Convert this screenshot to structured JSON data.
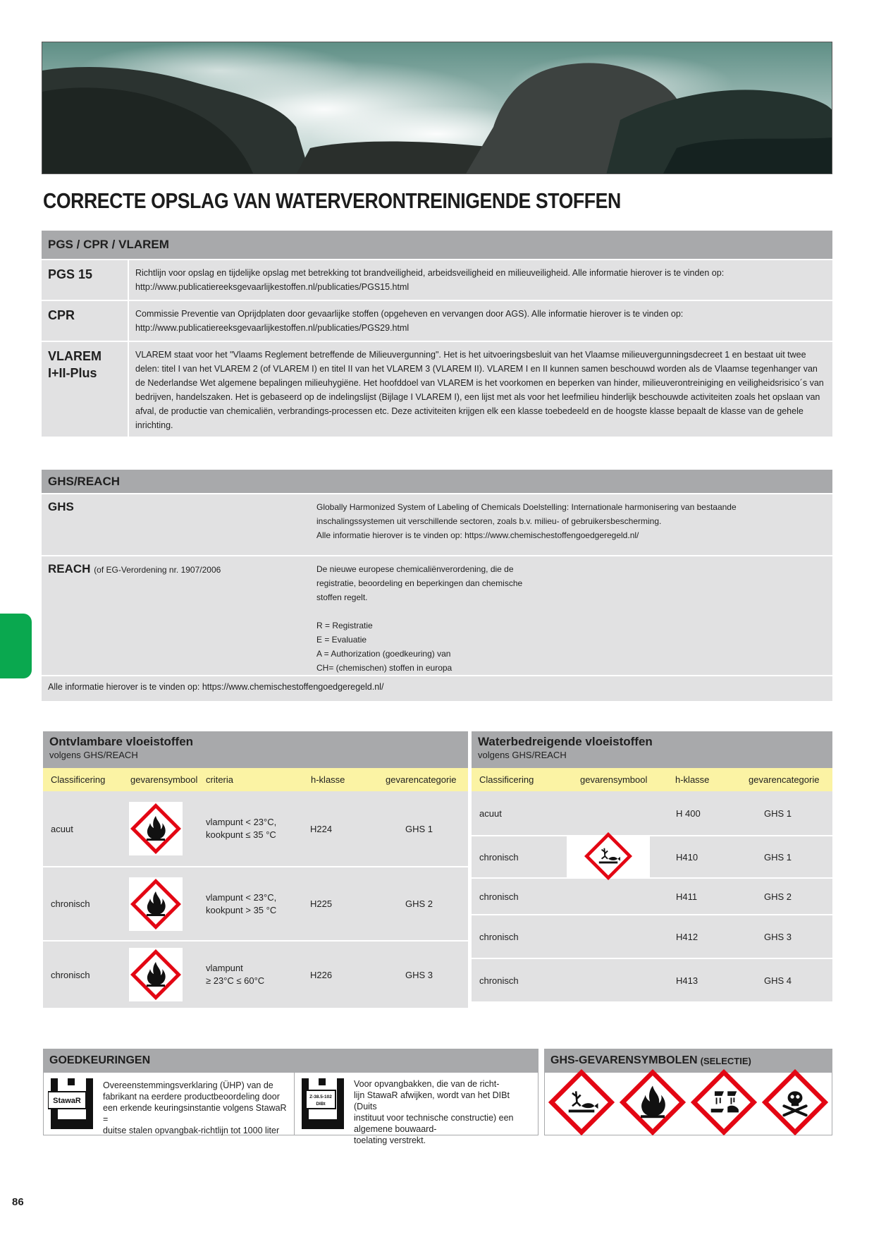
{
  "page_title": "CORRECTE OPSLAG VAN WATERVERONTREINIGENDE STOFFEN",
  "pgs": {
    "header": "PGS / CPR / VLAREM",
    "rows": [
      {
        "label": "PGS 15",
        "text": "Richtlijn voor opslag en tijdelijke opslag met betrekking tot brandveiligheid, arbeidsveiligheid en milieuveiligheid. Alle informatie hierover is te vinden op:",
        "url": "http://www.publicatiereeksgevaarlijkestoffen.nl/publicaties/PGS15.html"
      },
      {
        "label": "CPR",
        "text": "Commissie Preventie van Oprijdplaten door gevaarlijke stoffen (opgeheven en vervangen door AGS). Alle informatie hierover is te vinden op:",
        "url": "http://www.publicatiereeksgevaarlijkestoffen.nl/publicaties/PGS29.html"
      },
      {
        "label": "VLAREM I+II-Plus",
        "text": "VLAREM staat voor het \"Vlaams Reglement betreffende de Milieuvergunning\". Het is het uitvoeringsbesluit van het Vlaamse milieuvergunningsdecreet 1 en bestaat uit twee delen: titel I van het VLAREM 2 (of VLAREM I) en titel II van het VLAREM 3 (VLAREM II). VLAREM I en II kunnen samen beschouwd worden als de Vlaamse tegenhanger van de Nederlandse Wet algemene bepalingen milieuhygiëne. Het hoofddoel van VLAREM is het voorkomen en beperken van hinder, milieuverontreiniging en veiligheidsrisico´s van bedrijven, handelszaken. Het is gebaseerd op de indelingslijst (Bijlage I VLAREM I), een lijst met als voor het leefmilieu hinderlijk beschouwde activiteiten zoals het opslaan van afval, de productie van chemicaliën, verbrandings-processen etc. Deze activiteiten krijgen elk een klasse toebedeeld en de hoogste klasse bepaalt de klasse van de gehele inrichting.",
        "url": ""
      }
    ]
  },
  "ghs": {
    "header": "GHS/REACH",
    "ghs_label": "GHS",
    "ghs_lines": [
      "Globally Harmonized System of Labeling of Chemicals Doelstelling: Internationale harmonisering van bestaande",
      "inschalingssystemen uit verschillende sectoren, zoals b.v. milieu- of gebruikersbescherming.",
      "Alle informatie hierover is te vinden op: https://www.chemischestoffengoedgeregeld.nl/"
    ],
    "reach_label": "REACH",
    "reach_note": "(of EG-Verordening nr. 1907/2006",
    "reach_lines": [
      "De nieuwe europese chemicaliënverordening, die de",
      "registratie, beoordeling en beperkingen dan chemische",
      "stoffen regelt."
    ],
    "reach_list": [
      "R = Registratie",
      "E = Evaluatie",
      "A = Authorization (goedkeuring) van",
      "CH= (chemischen) stoffen in europa"
    ],
    "footer": "Alle informatie hierover is te vinden op: https://www.chemischestoffengoedgeregeld.nl/"
  },
  "flammable": {
    "title": "Ontvlambare vloeistoffen",
    "subtitle": "volgens GHS/REACH",
    "columns": [
      "Classificering",
      "gevarensymbool",
      "criteria",
      "h-klasse",
      "gevarencategorie"
    ],
    "rows": [
      {
        "class": "acuut",
        "symbol": "flame-icon",
        "criteria": [
          "vlampunt < 23°C,",
          "kookpunt ≤ 35 °C"
        ],
        "h": "H224",
        "cat": "GHS 1"
      },
      {
        "class": "chronisch",
        "symbol": "flame-icon",
        "criteria": [
          "vlampunt < 23°C,",
          "kookpunt > 35 °C"
        ],
        "h": "H225",
        "cat": "GHS 2"
      },
      {
        "class": "chronisch",
        "symbol": "flame-icon",
        "criteria": [
          "vlampunt",
          "≥ 23°C ≤ 60°C"
        ],
        "h": "H226",
        "cat": "GHS 3"
      }
    ]
  },
  "water": {
    "title": "Waterbedreigende vloeistoffen",
    "subtitle": "volgens GHS/REACH",
    "columns": [
      "Classificering",
      "gevarensymbool",
      "h-klasse",
      "gevarencategorie"
    ],
    "symbol": "environment-icon",
    "rows": [
      {
        "class": "acuut",
        "h": "H 400",
        "cat": "GHS 1"
      },
      {
        "class": "chronisch",
        "h": "H410",
        "cat": "GHS 1"
      },
      {
        "class": "chronisch",
        "h": "H411",
        "cat": "GHS 2"
      },
      {
        "class": "chronisch",
        "h": "H412",
        "cat": "GHS 3"
      },
      {
        "class": "chronisch",
        "h": "H413",
        "cat": "GHS 4"
      }
    ]
  },
  "approvals": {
    "header": "GOEDKEURINGEN",
    "items": [
      {
        "icon": "stawar-icon",
        "badge": "StawaR",
        "lines": [
          "Overeenstemmingsverklaring (ÜHP) van de",
          "fabrikant na eerdere productbeoordeling door",
          "een erkende keuringsinstantie volgens StawaR =",
          "duitse stalen opvangbak-richtlijn tot 1000 liter"
        ]
      },
      {
        "icon": "dibt-icon",
        "badge": "Z-38.5-102",
        "badge2": "DIBt",
        "lines": [
          "Voor opvangbakken, die van de richt-",
          "lijn StawaR afwijken, wordt van het DIBt (Duits",
          "instituut voor technische constructie) een",
          "algemene bouwaard-",
          "toelating verstrekt."
        ]
      }
    ]
  },
  "symbols": {
    "header": "GHS-GEVARENSYMBOLEN",
    "header_note": "(SELECTIE)",
    "items": [
      "environment-icon",
      "flame-icon",
      "corrosion-icon",
      "skull-icon"
    ]
  },
  "colors": {
    "header_gray": "#a8a9ab",
    "row_gray": "#e1e1e2",
    "col_yellow": "#fbf3a4",
    "tab_green": "#0aa84f",
    "ghs_red": "#e30613"
  },
  "page_number": "86"
}
